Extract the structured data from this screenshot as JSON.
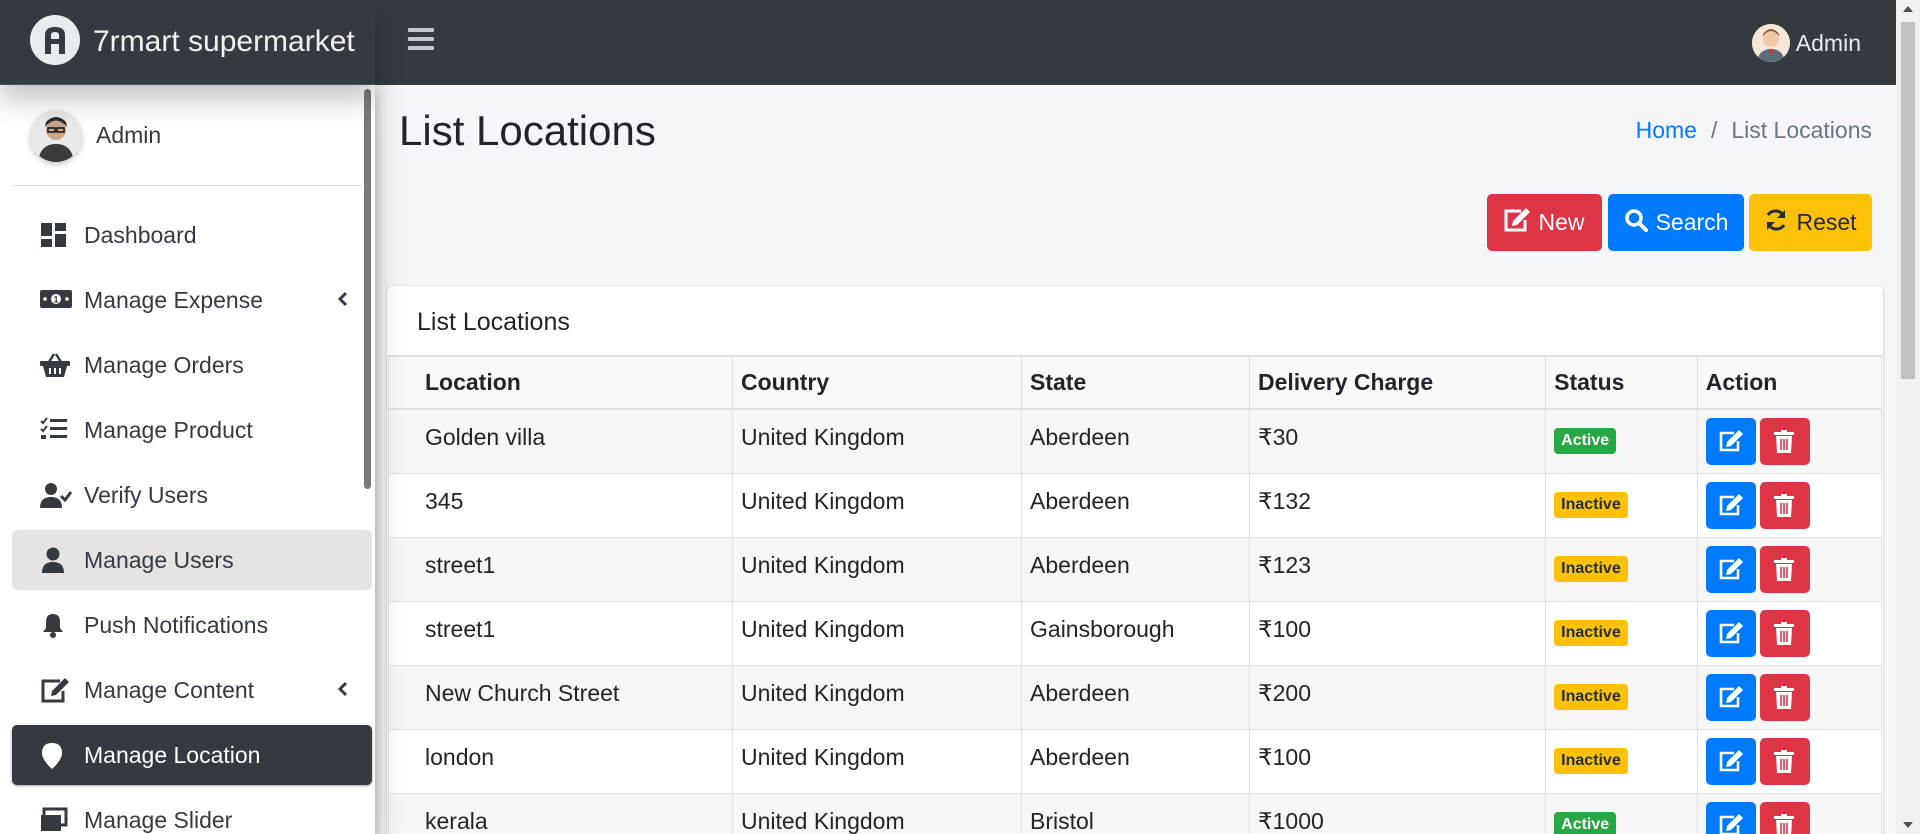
{
  "app": {
    "brand": "7rmart supermarket",
    "user_label": "Admin"
  },
  "sidebar": {
    "user_name": "Admin",
    "items": [
      {
        "label": "Dashboard",
        "icon": "dashboard-icon",
        "state": "normal",
        "has_chevron": false
      },
      {
        "label": "Manage Expense",
        "icon": "money-bill-icon",
        "state": "normal",
        "has_chevron": true
      },
      {
        "label": "Manage Orders",
        "icon": "basket-icon",
        "state": "normal",
        "has_chevron": false
      },
      {
        "label": "Manage Product",
        "icon": "tasks-list-icon",
        "state": "normal",
        "has_chevron": false
      },
      {
        "label": "Verify Users",
        "icon": "user-check-icon",
        "state": "normal",
        "has_chevron": false
      },
      {
        "label": "Manage Users",
        "icon": "user-icon",
        "state": "hover",
        "has_chevron": false
      },
      {
        "label": "Push Notifications",
        "icon": "bell-icon",
        "state": "normal",
        "has_chevron": false
      },
      {
        "label": "Manage Content",
        "icon": "edit-icon",
        "state": "normal",
        "has_chevron": true
      },
      {
        "label": "Manage Location",
        "icon": "map-pin-icon",
        "state": "active",
        "has_chevron": false
      },
      {
        "label": "Manage Slider",
        "icon": "slider-icon",
        "state": "normal",
        "has_chevron": false
      }
    ]
  },
  "page": {
    "title": "List Locations"
  },
  "breadcrumb": {
    "home": "Home",
    "separator": "/",
    "current": "List Locations"
  },
  "toolbar": {
    "new_label": "New",
    "search_label": "Search",
    "reset_label": "Reset"
  },
  "card": {
    "title": "List Locations"
  },
  "table": {
    "headers": [
      "Location",
      "Country",
      "State",
      "Delivery Charge",
      "Status",
      "Action"
    ],
    "rows": [
      {
        "location": "Golden villa",
        "country": "United Kingdom",
        "state": "Aberdeen",
        "charge": "₹30",
        "status": "Active"
      },
      {
        "location": "345",
        "country": "United Kingdom",
        "state": "Aberdeen",
        "charge": "₹132",
        "status": "Inactive"
      },
      {
        "location": "street1",
        "country": "United Kingdom",
        "state": "Aberdeen",
        "charge": "₹123",
        "status": "Inactive"
      },
      {
        "location": "street1",
        "country": "United Kingdom",
        "state": "Gainsborough",
        "charge": "₹100",
        "status": "Inactive"
      },
      {
        "location": "New Church Street",
        "country": "United Kingdom",
        "state": "Aberdeen",
        "charge": "₹200",
        "status": "Inactive"
      },
      {
        "location": "london",
        "country": "United Kingdom",
        "state": "Aberdeen",
        "charge": "₹100",
        "status": "Inactive"
      },
      {
        "location": "kerala",
        "country": "United Kingdom",
        "state": "Bristol",
        "charge": "₹1000",
        "status": "Active"
      }
    ]
  },
  "colors": {
    "navbar": "#343a40",
    "primary": "#007bff",
    "danger": "#dc3545",
    "warning": "#ffc107",
    "success": "#28a745"
  }
}
